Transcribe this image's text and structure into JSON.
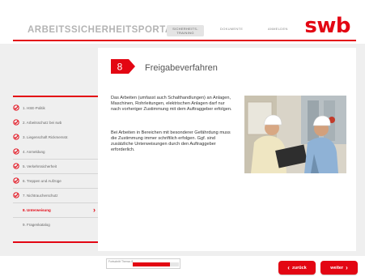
{
  "header": {
    "portal_title": "ARBEITSSICHERHEITSPORTAL",
    "nav": [
      {
        "label": "SICHERHEITS-TRAINING",
        "active": true
      },
      {
        "label": "DOKUMENTE",
        "active": false
      },
      {
        "label": "ANMELDEN",
        "active": false
      }
    ],
    "logo": "swb"
  },
  "sidebar": {
    "items": [
      {
        "label": "1. HSE-Politik",
        "done": true
      },
      {
        "label": "2. Arbeitsschutz bei swb",
        "done": true
      },
      {
        "label": "3. Liegenschaft Rickmersstr.",
        "done": true
      },
      {
        "label": "4. Anmeldung",
        "done": true
      },
      {
        "label": "5. Verkehrssicherheit",
        "done": true
      },
      {
        "label": "6. Treppen und Aufzüge",
        "done": true
      },
      {
        "label": "7. Nichtraucherschutz",
        "done": true
      },
      {
        "label": "8. Unterweisung",
        "active": true
      },
      {
        "label": "9. Fragenkatalog"
      }
    ]
  },
  "content": {
    "section_number": "8",
    "section_title": "Freigabeverfahren",
    "paragraph1": "Das Arbeiten (umfasst auch Schalthandlungen) an Anlagen, Maschinen, Rohrleitungen, elektrischen Anlagen darf nur nach vorheriger Zustimmung mit dem Auftraggeber erfolgen.",
    "paragraph2": "Bei Arbeiten in Bereichen mit besonderer Gefährdung muss die Zustimmung immer schriftlich erfolgen. Ggf. sind zusätzliche Unterweisungen durch den Auftraggeber erforderlich."
  },
  "progress": {
    "label": "Fortschritt Thema: 8",
    "value": 0.8
  },
  "buttons": {
    "back": "zurück",
    "next": "weiter"
  },
  "colors": {
    "accent": "#e30613",
    "band": "#efefef"
  }
}
